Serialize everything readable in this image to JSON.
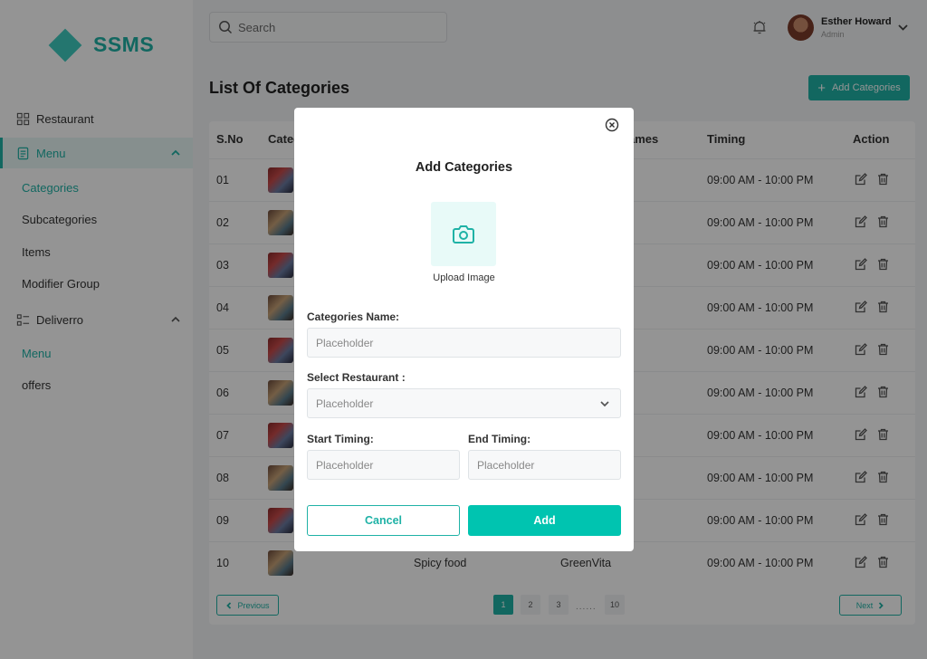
{
  "brand": {
    "name": "SSMS"
  },
  "header": {
    "search_placeholder": "Search",
    "user_name": "Esther Howard",
    "user_role": "Admin"
  },
  "sidebar": {
    "restaurant": "Restaurant",
    "menu": "Menu",
    "menu_items": [
      "Categories",
      "Subcategories",
      "Items",
      "Modifier Group"
    ],
    "deliverro": "Deliverro",
    "deliverro_items": [
      "Menu",
      "offers"
    ]
  },
  "main": {
    "title": "List Of Categories",
    "add_button": "Add Categories",
    "columns": {
      "sno": "S.No",
      "category": "Categ",
      "names": "ames",
      "timing": "Timing",
      "action": "Action"
    },
    "rows": [
      {
        "sno": "01",
        "timing": "09:00 AM - 10:00 PM"
      },
      {
        "sno": "02",
        "timing": "09:00 AM - 10:00 PM"
      },
      {
        "sno": "03",
        "timing": "09:00 AM - 10:00 PM"
      },
      {
        "sno": "04",
        "timing": "09:00 AM - 10:00 PM"
      },
      {
        "sno": "05",
        "timing": "09:00 AM - 10:00 PM"
      },
      {
        "sno": "06",
        "timing": "09:00 AM - 10:00 PM"
      },
      {
        "sno": "07",
        "timing": "09:00 AM - 10:00 PM"
      },
      {
        "sno": "08",
        "timing": "09:00 AM - 10:00 PM"
      },
      {
        "sno": "09",
        "timing": "09:00 AM - 10:00 PM"
      },
      {
        "sno": "10",
        "category": "Spicy food",
        "restaurant": "GreenVita",
        "timing": "09:00 AM - 10:00 PM"
      }
    ],
    "pagination": {
      "previous": "Previous",
      "next": "Next",
      "pages": [
        "1",
        "2",
        "3",
        "10"
      ],
      "ellipsis": "......",
      "current": "1"
    }
  },
  "modal": {
    "title": "Add Categories",
    "upload_label": "Upload Image",
    "name_label": "Categories Name:",
    "name_placeholder": "Placeholder",
    "restaurant_label": "Select Restaurant :",
    "restaurant_placeholder": "Placeholder",
    "start_label": "Start Timing:",
    "start_placeholder": "Placeholder",
    "end_label": "End Timing:",
    "end_placeholder": "Placeholder",
    "cancel": "Cancel",
    "add": "Add"
  },
  "colors": {
    "accent": "#1fb2a6",
    "add_button": "#00c4b0"
  }
}
